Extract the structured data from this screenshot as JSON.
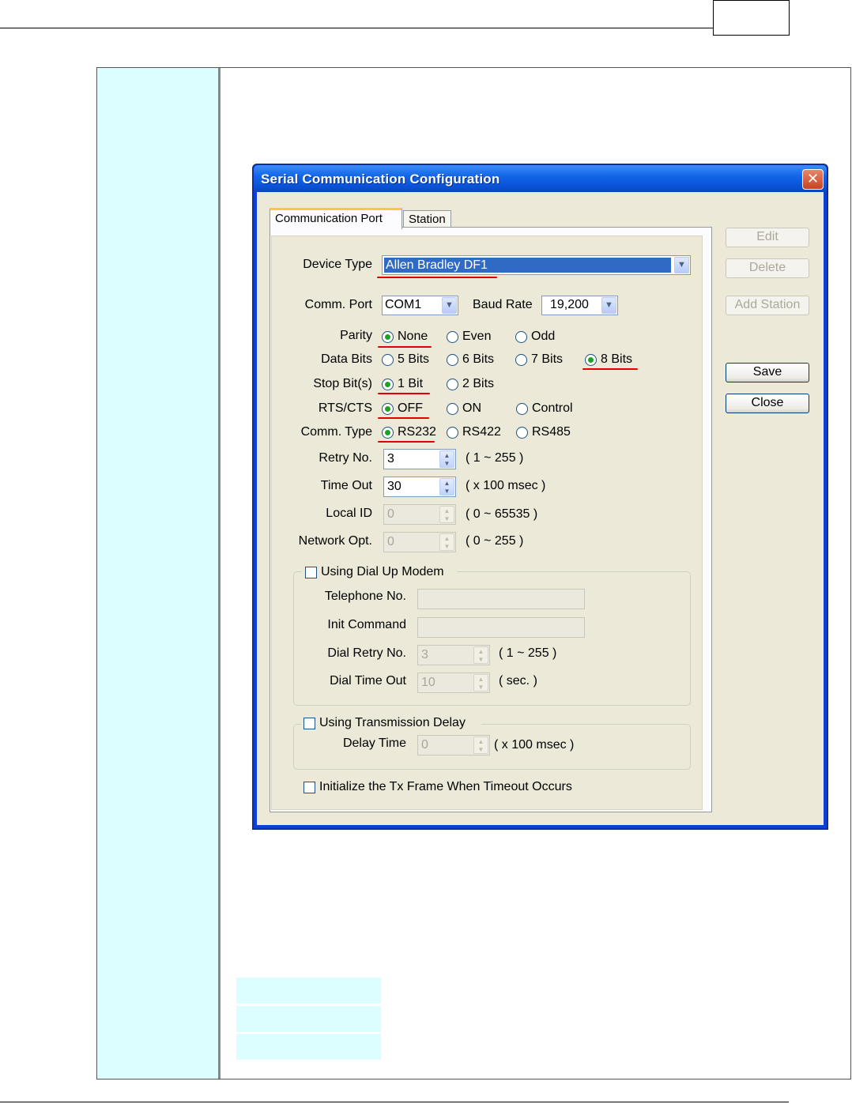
{
  "dialog": {
    "title": "Serial Communication Configuration",
    "close_glyph": "✕",
    "tabs": [
      "Communication Port",
      "Station"
    ],
    "side_buttons": {
      "edit": "Edit",
      "delete": "Delete",
      "add_station": "Add Station",
      "save": "Save",
      "close": "Close"
    },
    "device_type": {
      "label": "Device Type",
      "value": "Allen Bradley DF1"
    },
    "comm_port": {
      "label": "Comm. Port",
      "value": "COM1"
    },
    "baud_rate": {
      "label": "Baud Rate",
      "value": "19,200"
    },
    "parity": {
      "label": "Parity",
      "options": [
        "None",
        "Even",
        "Odd"
      ],
      "selected": "None"
    },
    "data_bits": {
      "label": "Data Bits",
      "options": [
        "5 Bits",
        "6 Bits",
        "7 Bits",
        "8 Bits"
      ],
      "selected": "8 Bits"
    },
    "stop_bits": {
      "label": "Stop Bit(s)",
      "options": [
        "1 Bit",
        "2 Bits"
      ],
      "selected": "1 Bit"
    },
    "rts_cts": {
      "label": "RTS/CTS",
      "options": [
        "OFF",
        "ON",
        "Control"
      ],
      "selected": "OFF"
    },
    "comm_type": {
      "label": "Comm. Type",
      "options": [
        "RS232",
        "RS422",
        "RS485"
      ],
      "selected": "RS232"
    },
    "retry_no": {
      "label": "Retry No.",
      "value": "3",
      "range": "( 1 ~ 255 )"
    },
    "time_out": {
      "label": "Time Out",
      "value": "30",
      "range": "( x 100 msec )"
    },
    "local_id": {
      "label": "Local ID",
      "value": "0",
      "range": "( 0 ~ 65535 )"
    },
    "network_opt": {
      "label": "Network Opt.",
      "value": "0",
      "range": "( 0 ~ 255 )"
    },
    "dial_up": {
      "label": "Using Dial Up Modem",
      "telephone_label": "Telephone No.",
      "telephone_value": "",
      "init_label": "Init Command",
      "init_value": "",
      "dial_retry_label": "Dial Retry No.",
      "dial_retry_value": "3",
      "dial_retry_range": "( 1 ~ 255 )",
      "dial_timeout_label": "Dial Time Out",
      "dial_timeout_value": "10",
      "dial_timeout_range": "( sec. )"
    },
    "tx_delay": {
      "label": "Using Transmission Delay",
      "delay_label": "Delay Time",
      "delay_value": "0",
      "delay_range": "( x 100 msec )"
    },
    "init_tx": {
      "label": "Initialize the Tx Frame When Timeout  Occurs"
    }
  },
  "colors": {
    "title_bar": "#0a52d6",
    "dialog_face": "#ece9d8",
    "side_column": "#dcfefe",
    "annotation_underline": "#e00000",
    "radio_dot": "#21a121"
  }
}
